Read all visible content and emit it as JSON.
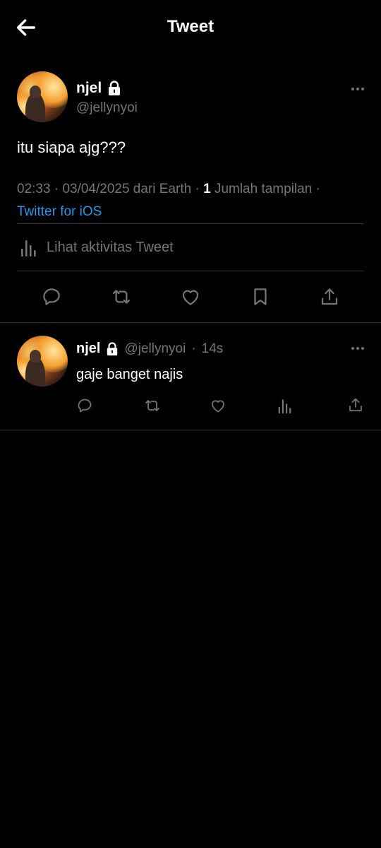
{
  "header": {
    "title": "Tweet",
    "back_icon": "arrow-left-icon"
  },
  "tweet": {
    "name": "njel",
    "handle": "@jellynyoi",
    "text": "itu siapa ajg???",
    "time": "02:33",
    "date": "03/04/2025 dari Earth",
    "views_count": "1",
    "views_label": "Jumlah tampilan",
    "source": "Twitter for iOS",
    "activity_label": "Lihat aktivitas Tweet"
  },
  "reply": {
    "name": "njel",
    "handle": "@jellynyoi",
    "age": "14s",
    "text": "gaje banget najis"
  },
  "colors": {
    "background": "#000000",
    "link": "#1d9bf0",
    "secondary": "#71767b",
    "divider": "#2f3336"
  }
}
